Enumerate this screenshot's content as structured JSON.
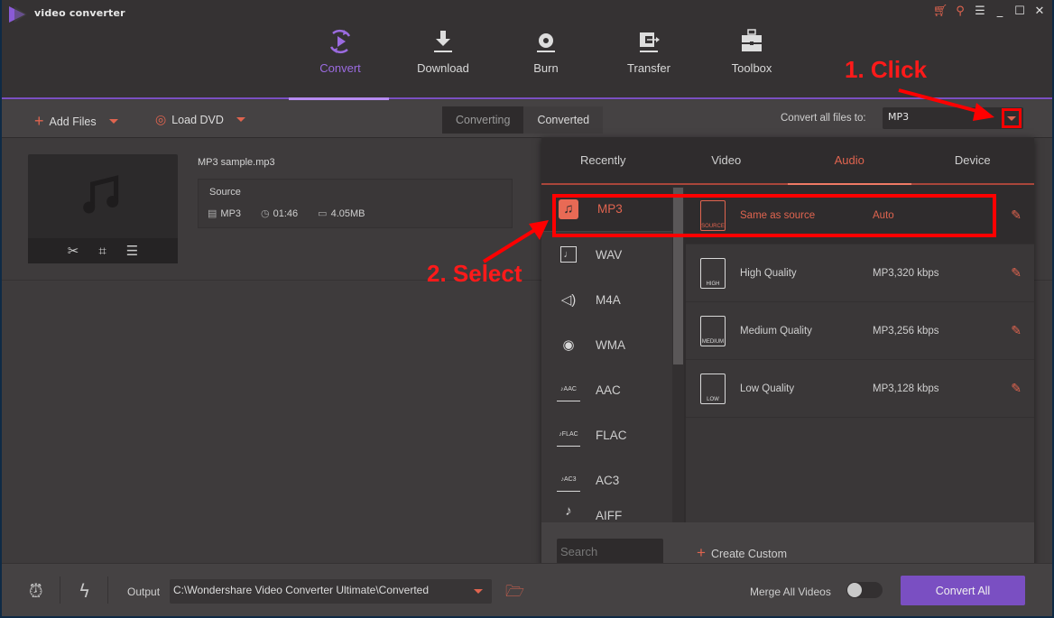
{
  "app": {
    "title": "video converter"
  },
  "window_controls": {
    "cart": "cart-icon",
    "key": "key-icon",
    "menu": "menu-icon",
    "minimize": "minimize-icon",
    "maximize": "maximize-icon",
    "close": "close-icon"
  },
  "nav": {
    "items": [
      {
        "label": "Convert",
        "icon": "convert-icon",
        "active": true
      },
      {
        "label": "Download",
        "icon": "download-icon"
      },
      {
        "label": "Burn",
        "icon": "burn-icon"
      },
      {
        "label": "Transfer",
        "icon": "transfer-icon"
      },
      {
        "label": "Toolbox",
        "icon": "toolbox-icon"
      }
    ]
  },
  "toolbar": {
    "add_files": "Add Files",
    "load_dvd": "Load DVD",
    "segments": [
      "Converting",
      "Converted"
    ],
    "convert_all_label": "Convert all files to:",
    "convert_all_value": "MP3"
  },
  "file": {
    "name": "MP3 sample.mp3",
    "source_label": "Source",
    "format": "MP3",
    "duration": "01:46",
    "size": "4.05MB"
  },
  "popup": {
    "tabs": [
      "Recently",
      "Video",
      "Audio",
      "Device"
    ],
    "active_tab": "Audio",
    "formats": [
      "MP3",
      "WAV",
      "M4A",
      "WMA",
      "AAC",
      "FLAC",
      "AC3",
      "AIFF"
    ],
    "active_format": "MP3",
    "qualities": [
      {
        "name": "Same as source",
        "value": "Auto",
        "badge": "SOURCE"
      },
      {
        "name": "High Quality",
        "value": "MP3,320 kbps",
        "badge": "HIGH"
      },
      {
        "name": "Medium Quality",
        "value": "MP3,256 kbps",
        "badge": "MEDIUM"
      },
      {
        "name": "Low Quality",
        "value": "MP3,128 kbps",
        "badge": "LOW"
      }
    ],
    "search_placeholder": "Search",
    "create_custom": "Create Custom"
  },
  "annotations": {
    "step1": "1. Click",
    "step2": "2. Select"
  },
  "bottom": {
    "output_label": "Output",
    "output_path": "C:\\Wondershare Video Converter Ultimate\\Converted",
    "merge_label": "Merge All Videos",
    "merge_on": false,
    "convert_all": "Convert All"
  },
  "colors": {
    "accent": "#e0644f",
    "brand": "#7a4fc2",
    "annotation": "#ff0000"
  }
}
